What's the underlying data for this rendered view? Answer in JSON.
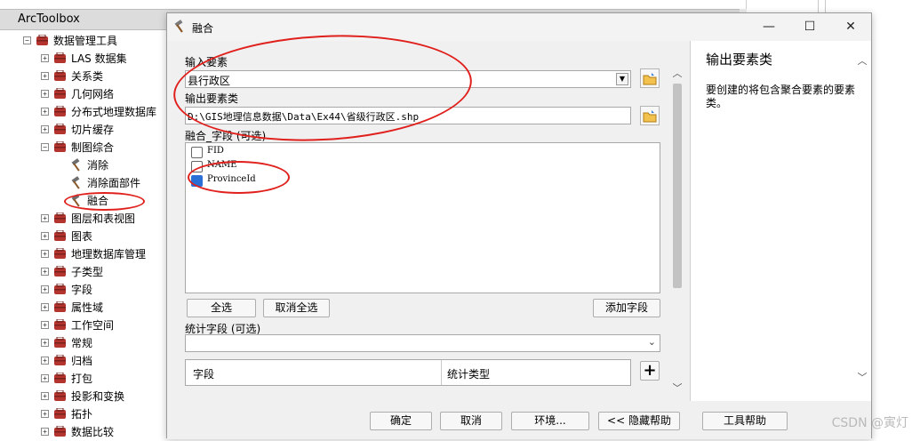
{
  "toolbox": {
    "title": "ArcToolbox",
    "tree": [
      {
        "label": "数据管理工具",
        "expander": "⊟",
        "icon": "toolbox-icon",
        "level": 0
      },
      {
        "label": "LAS 数据集",
        "expander": "+",
        "icon": "toolset-icon",
        "level": 1
      },
      {
        "label": "关系类",
        "expander": "+",
        "icon": "toolset-icon",
        "level": 1
      },
      {
        "label": "几何网络",
        "expander": "+",
        "icon": "toolset-icon",
        "level": 1
      },
      {
        "label": "分布式地理数据库",
        "expander": "+",
        "icon": "toolset-icon",
        "level": 1
      },
      {
        "label": "切片缓存",
        "expander": "+",
        "icon": "toolset-icon",
        "level": 1
      },
      {
        "label": "制图综合",
        "expander": "−",
        "icon": "toolset-icon",
        "level": 1
      },
      {
        "label": "消除",
        "expander": "",
        "icon": "hammer-icon",
        "level": 2
      },
      {
        "label": "消除面部件",
        "expander": "",
        "icon": "hammer-icon",
        "level": 2
      },
      {
        "label": "融合",
        "expander": "",
        "icon": "hammer-icon",
        "level": 2
      },
      {
        "label": "图层和表视图",
        "expander": "+",
        "icon": "toolset-icon",
        "level": 1
      },
      {
        "label": "图表",
        "expander": "+",
        "icon": "toolset-icon",
        "level": 1
      },
      {
        "label": "地理数据库管理",
        "expander": "+",
        "icon": "toolset-icon",
        "level": 1
      },
      {
        "label": "子类型",
        "expander": "+",
        "icon": "toolset-icon",
        "level": 1
      },
      {
        "label": "字段",
        "expander": "+",
        "icon": "toolset-icon",
        "level": 1
      },
      {
        "label": "属性域",
        "expander": "+",
        "icon": "toolset-icon",
        "level": 1
      },
      {
        "label": "工作空间",
        "expander": "+",
        "icon": "toolset-icon",
        "level": 1
      },
      {
        "label": "常规",
        "expander": "+",
        "icon": "toolset-icon",
        "level": 1
      },
      {
        "label": "归档",
        "expander": "+",
        "icon": "toolset-icon",
        "level": 1
      },
      {
        "label": "打包",
        "expander": "+",
        "icon": "toolset-icon",
        "level": 1
      },
      {
        "label": "投影和变换",
        "expander": "+",
        "icon": "toolset-icon",
        "level": 1
      },
      {
        "label": "拓扑",
        "expander": "+",
        "icon": "toolset-icon",
        "level": 1
      },
      {
        "label": "数据比较",
        "expander": "+",
        "icon": "toolset-icon",
        "level": 1
      }
    ]
  },
  "dialog": {
    "title": "融合",
    "window_buttons": {
      "minimize": "—",
      "maximize": "☐",
      "close": "✕"
    },
    "input_label": "输入要素",
    "input_value": "县行政区",
    "output_label": "输出要素类",
    "output_value": "D:\\GIS地理信息数据\\Data\\Ex44\\省级行政区.shp",
    "dissolve_label": "融合_字段 (可选)",
    "fields": [
      {
        "name": "FID",
        "checked": false
      },
      {
        "name": "NAME",
        "checked": false
      },
      {
        "name": "ProvinceId",
        "checked": true
      }
    ],
    "select_all": "全选",
    "clear_all": "取消全选",
    "add_field": "添加字段",
    "stats_label": "统计字段 (可选)",
    "stats_value": "",
    "table_col_field": "字段",
    "table_col_type": "统计类型",
    "add_row": "+",
    "buttons": {
      "ok": "确定",
      "cancel": "取消",
      "env": "环境...",
      "hide_help": "<< 隐藏帮助",
      "tool_help": "工具帮助"
    }
  },
  "help": {
    "title": "输出要素类",
    "text": "要创建的将包含聚合要素的要素类。"
  },
  "watermark": "CSDN @寅灯",
  "colors": {
    "annotation": "#e0201c",
    "checkbox": "#2a6fd6",
    "toolset": "#b3342e"
  }
}
